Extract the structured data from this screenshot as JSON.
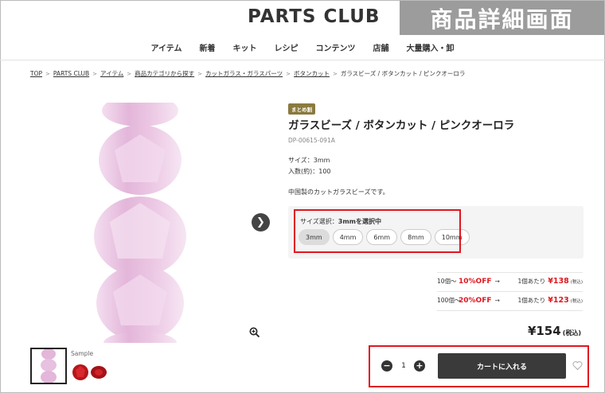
{
  "header": {
    "logo": "PARTS CLUB",
    "corner_label": "商品詳細画面"
  },
  "nav": {
    "items": [
      "アイテム",
      "新着",
      "キット",
      "レシピ",
      "コンテンツ",
      "店舗",
      "大量購入・卸"
    ]
  },
  "breadcrumb": {
    "links": [
      "TOP",
      "PARTS CLUB",
      "アイテム",
      "商品カテゴリから探す",
      "カットガラス・ガラスパーツ",
      "ボタンカット"
    ],
    "current": "ガラスビーズ / ボタンカット / ピンクオーロラ",
    "separator": ">"
  },
  "gallery": {
    "sample_label": "Sample",
    "next_icon": "chevron-right-icon",
    "zoom_icon": "zoom-in-icon"
  },
  "product": {
    "badge": "まとめ割",
    "title": "ガラスビーズ / ボタンカット / ピンクオーロラ",
    "sku": "DP-00615-091A",
    "size": "サイズ：3mm",
    "count": "入数(約)：100",
    "description": "中国製のカットガラスビーズです。"
  },
  "variants": {
    "label": "サイズ選択：",
    "selected_text": "3mmを選択中",
    "options": [
      "3mm",
      "4mm",
      "6mm",
      "8mm",
      "10mm"
    ],
    "selected": "3mm"
  },
  "tiers": [
    {
      "qty": "10個〜",
      "off": "10%OFF",
      "arrow": "→",
      "per": "1個あたり",
      "price": "¥138",
      "tax": "(税込)"
    },
    {
      "qty": "100個〜",
      "off": "20%OFF",
      "arrow": "→",
      "per": "1個あたり",
      "price": "¥123",
      "tax": "(税込)"
    }
  ],
  "total": {
    "price": "¥154",
    "tax": "(税込)"
  },
  "cart": {
    "minus": "−",
    "plus": "+",
    "quantity": "1",
    "button_label": "カートに入れる",
    "favorite_icon": "heart-icon"
  },
  "colors": {
    "accent_red": "#e0171f",
    "badge_gold": "#8a7a3e",
    "button_dark": "#3a3a3a",
    "bead_pink": "#e9c6e2"
  }
}
